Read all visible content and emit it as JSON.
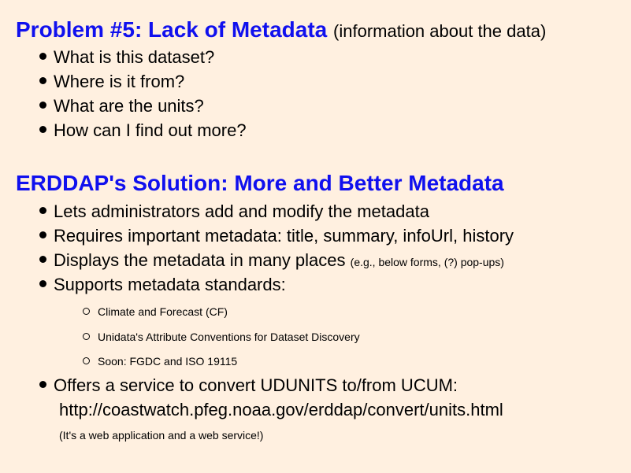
{
  "problem": {
    "title": "Problem #5: Lack of Metadata",
    "subtitle": "(information about the data)",
    "questions": [
      "What is this dataset?",
      "Where is it from?",
      "What are the units?",
      "How can I find out more?"
    ]
  },
  "solution": {
    "title": "ERDDAP's Solution: More and Better Metadata",
    "points": [
      {
        "text": "Lets administrators add and modify the metadata"
      },
      {
        "text": "Requires important metadata: title, summary, infoUrl, history"
      },
      {
        "text": "Displays the metadata in many places",
        "note": "(e.g., below forms, (?) pop-ups)"
      },
      {
        "text": "Supports metadata standards:"
      }
    ],
    "standards": [
      "Climate and Forecast (CF)",
      "Unidata's Attribute Conventions for Dataset Discovery",
      "Soon: FGDC and ISO 19115"
    ],
    "service": {
      "text": "Offers a service to convert UDUNITS to/from UCUM:",
      "url": "http://coastwatch.pfeg.noaa.gov/erddap/convert/units.html",
      "note": "(It's a web application and a web service!)"
    }
  }
}
